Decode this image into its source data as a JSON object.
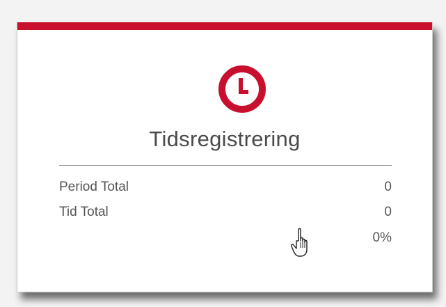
{
  "widget": {
    "title": "Tidsregistrering",
    "icon": "clock-icon",
    "accent_color": "#c8102e",
    "rows": [
      {
        "label": "Period Total",
        "value": "0"
      },
      {
        "label": "Tid Total",
        "value": "0"
      },
      {
        "label": "",
        "value": "0%"
      }
    ]
  },
  "cursor": {
    "icon": "hand-pointer-icon"
  }
}
